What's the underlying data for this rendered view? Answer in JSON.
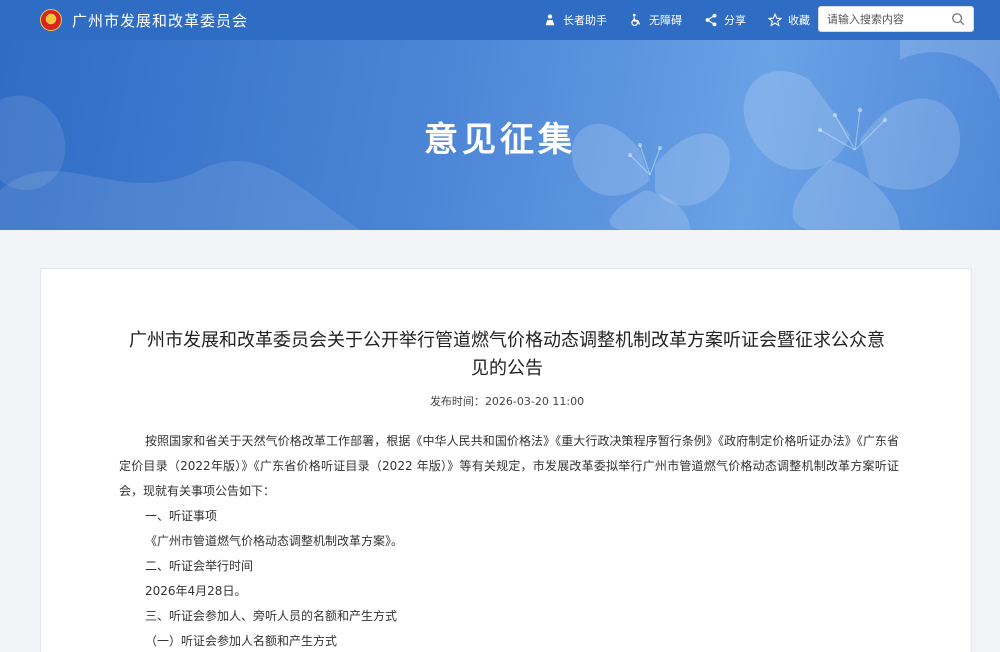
{
  "header": {
    "site_title": "广州市发展和改革委员会",
    "tools": [
      {
        "label": "长者助手",
        "icon": "elder-assist-icon"
      },
      {
        "label": "无障碍",
        "icon": "wheelchair-icon"
      },
      {
        "label": "分享",
        "icon": "share-icon"
      },
      {
        "label": "收藏",
        "icon": "star-icon"
      }
    ],
    "search": {
      "placeholder": "请输入搜索内容",
      "icon": "search-icon"
    }
  },
  "banner": {
    "title": "意见征集"
  },
  "article": {
    "title": "广州市发展和改革委员会关于公开举行管道燃气价格动态调整机制改革方案听证会暨征求公众意见的公告",
    "publish_label": "发布时间：",
    "publish_time": "2026-03-20 11:00",
    "intro": "按照国家和省关于天然气价格改革工作部署，根据《中华人民共和国价格法》《重大行政决策程序暂行条例》《政府制定价格听证办法》《广东省定价目录（2022年版）》《广东省价格听证目录（2022 年版）》等有关规定，市发展改革委拟举行广州市管道燃气价格动态调整机制改革方案听证会，现就有关事项公告如下：",
    "lines": [
      "一、听证事项",
      "《广州市管道燃气价格动态调整机制改革方案》。",
      "二、听证会举行时间",
      "2026年4月28日。",
      "三、听证会参加人、旁听人员的名额和产生方式",
      "（一）听证会参加人名额和产生方式"
    ]
  },
  "colors": {
    "header_bg": "#2f6cc4",
    "banner_start": "#2f6cc4",
    "banner_end": "#6aa2e6",
    "page_bg": "#f2f4f7"
  }
}
